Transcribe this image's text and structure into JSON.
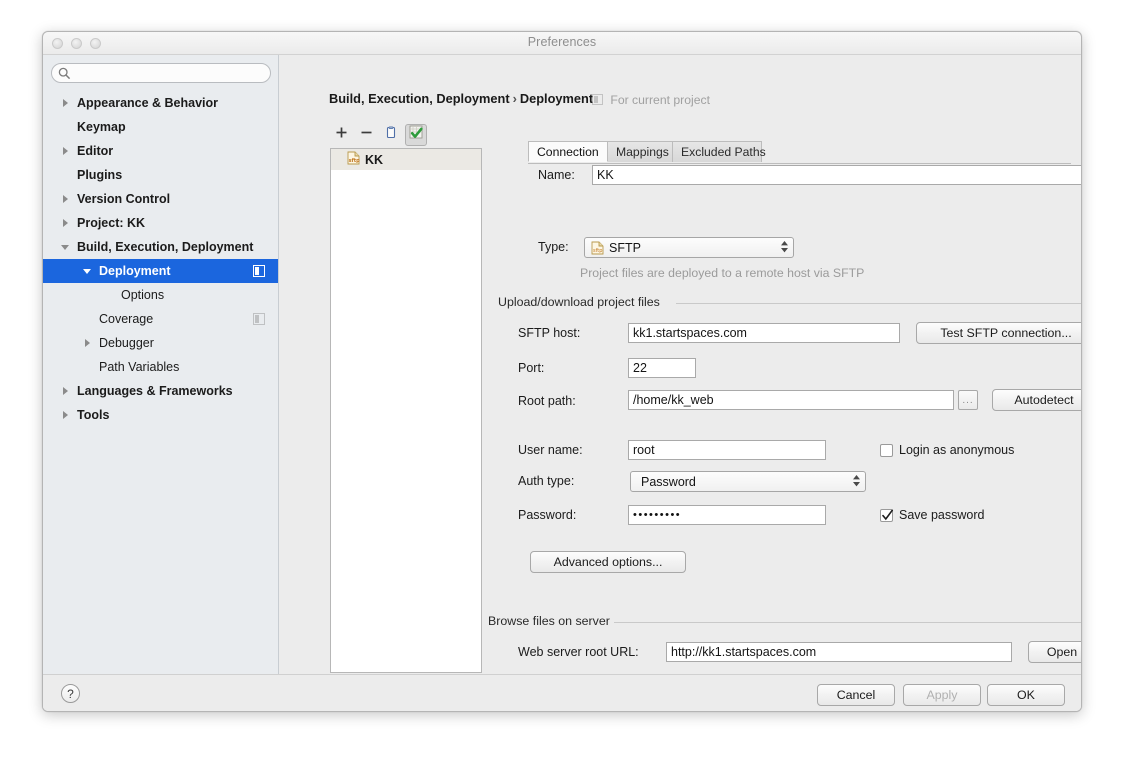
{
  "window": {
    "title": "Preferences",
    "traffic_lights": [
      "close-button",
      "minimize-button",
      "zoom-button"
    ]
  },
  "sidebar": {
    "search": {
      "value": "",
      "placeholder": "",
      "icon": "search-icon"
    },
    "items": [
      {
        "label": "Appearance & Behavior",
        "indent": 0,
        "twisty": "collapsed",
        "bold": true,
        "selected": false,
        "scope_icon": false
      },
      {
        "label": "Keymap",
        "indent": 0,
        "twisty": "none",
        "bold": true,
        "selected": false,
        "scope_icon": false
      },
      {
        "label": "Editor",
        "indent": 0,
        "twisty": "collapsed",
        "bold": true,
        "selected": false,
        "scope_icon": false
      },
      {
        "label": "Plugins",
        "indent": 0,
        "twisty": "none",
        "bold": true,
        "selected": false,
        "scope_icon": false
      },
      {
        "label": "Version Control",
        "indent": 0,
        "twisty": "collapsed",
        "bold": true,
        "selected": false,
        "scope_icon": false
      },
      {
        "label": "Project: KK",
        "indent": 0,
        "twisty": "collapsed",
        "bold": true,
        "selected": false,
        "scope_icon": false
      },
      {
        "label": "Build, Execution, Deployment",
        "indent": 0,
        "twisty": "expanded",
        "bold": true,
        "selected": false,
        "scope_icon": false
      },
      {
        "label": "Deployment",
        "indent": 1,
        "twisty": "expanded",
        "bold": true,
        "selected": true,
        "scope_icon": true
      },
      {
        "label": "Options",
        "indent": 2,
        "twisty": "none",
        "bold": false,
        "selected": false,
        "scope_icon": false
      },
      {
        "label": "Coverage",
        "indent": 1,
        "twisty": "none",
        "bold": false,
        "selected": false,
        "scope_icon": true
      },
      {
        "label": "Debugger",
        "indent": 1,
        "twisty": "collapsed",
        "bold": false,
        "selected": false,
        "scope_icon": false
      },
      {
        "label": "Path Variables",
        "indent": 1,
        "twisty": "none",
        "bold": false,
        "selected": false,
        "scope_icon": false
      },
      {
        "label": "Languages & Frameworks",
        "indent": 0,
        "twisty": "collapsed",
        "bold": true,
        "selected": false,
        "scope_icon": false
      },
      {
        "label": "Tools",
        "indent": 0,
        "twisty": "collapsed",
        "bold": true,
        "selected": false,
        "scope_icon": false
      }
    ]
  },
  "header": {
    "breadcrumb_root": "Build, Execution, Deployment",
    "breadcrumb_sep": "›",
    "breadcrumb_leaf": "Deployment",
    "scope_note": "For current project",
    "scope_note_icon": "project-scope-icon"
  },
  "list_toolbar": {
    "buttons": [
      {
        "name": "add-server-button",
        "icon": "plus-icon",
        "pressed": false
      },
      {
        "name": "remove-server-button",
        "icon": "minus-icon",
        "pressed": false
      },
      {
        "name": "copy-server-button",
        "icon": "copy-icon",
        "pressed": false
      },
      {
        "name": "set-default-server-button",
        "icon": "checkmark-icon",
        "pressed": true
      }
    ]
  },
  "server_list": {
    "items": [
      {
        "label": "KK",
        "icon": "sftp-file-icon",
        "selected": true
      }
    ]
  },
  "form": {
    "name_label": "Name:",
    "name_value": "KK",
    "tabs": [
      {
        "label": "Connection",
        "active": true
      },
      {
        "label": "Mappings",
        "active": false
      },
      {
        "label": "Excluded Paths",
        "active": false
      }
    ],
    "type_label": "Type:",
    "type_value": "SFTP",
    "type_icon": "sftp-file-icon",
    "type_hint": "Project files are deployed to a remote host via SFTP",
    "upload_group_title": "Upload/download project files",
    "host_label": "SFTP host:",
    "host_value": "kk1.startspaces.com",
    "test_connection_label": "Test SFTP connection...",
    "port_label": "Port:",
    "port_value": "22",
    "root_path_label": "Root path:",
    "root_path_value": "/home/kk_web",
    "browse_ellipsis_label": "...",
    "autodetect_label": "Autodetect",
    "username_label": "User name:",
    "username_value": "root",
    "login_anonymous_label": "Login as anonymous",
    "login_anonymous_checked": false,
    "auth_type_label": "Auth type:",
    "auth_type_value": "Password",
    "password_label": "Password:",
    "password_value": "•••••••••",
    "save_password_label": "Save password",
    "save_password_checked": true,
    "advanced_options_label": "Advanced options...",
    "browse_group_title": "Browse files on server",
    "web_url_label": "Web server root URL:",
    "web_url_value": "http://kk1.startspaces.com",
    "open_label": "Open"
  },
  "footer": {
    "help_label": "?",
    "cancel_label": "Cancel",
    "apply_label": "Apply",
    "apply_enabled": false,
    "ok_label": "OK"
  },
  "colors": {
    "selection_blue": "#1b66de",
    "window_bg": "#ececec",
    "sidebar_bg": "#e9ecef",
    "list_item_bg": "#ebe9e4",
    "hint_gray": "#9b9b9b"
  }
}
